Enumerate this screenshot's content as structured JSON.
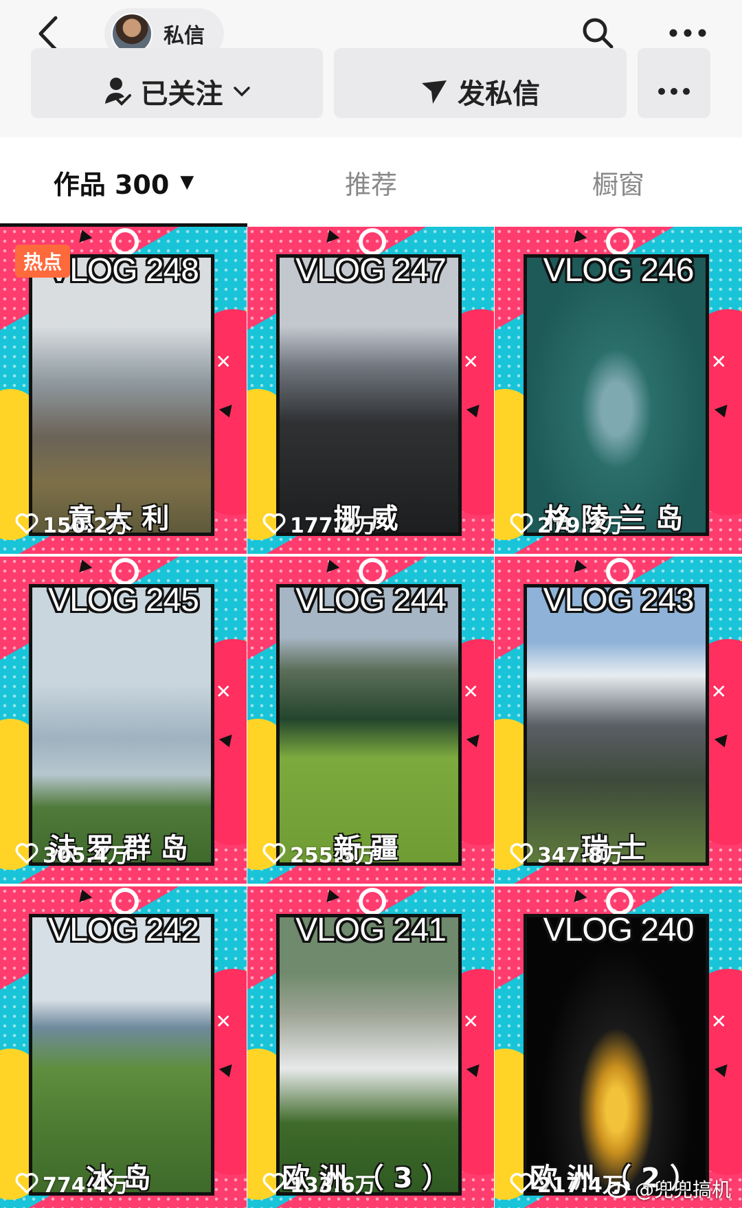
{
  "header": {
    "dm_label": "私信"
  },
  "actions": {
    "follow_label": "已关注",
    "message_label": "发私信"
  },
  "tabs": [
    {
      "label": "作品 300",
      "active": true
    },
    {
      "label": "推荐",
      "active": false
    },
    {
      "label": "橱窗",
      "active": false
    }
  ],
  "videos": [
    {
      "title": "VLOG 248",
      "place": "意大利",
      "likes": "150.2万",
      "badge": "热点"
    },
    {
      "title": "VLOG 247",
      "place": "挪威",
      "likes": "177.2万"
    },
    {
      "title": "VLOG 246",
      "place": "格陵兰岛",
      "likes": "279.2万"
    },
    {
      "title": "VLOG 245",
      "place": "法罗群岛",
      "likes": "305.4万"
    },
    {
      "title": "VLOG 244",
      "place": "新疆",
      "likes": "255.5万"
    },
    {
      "title": "VLOG 243",
      "place": "瑞士",
      "likes": "347.8万"
    },
    {
      "title": "VLOG 242",
      "place": "冰岛",
      "likes": "774.4万"
    },
    {
      "title": "VLOG 241",
      "place": "欧洲（3）",
      "likes": "133.6万"
    },
    {
      "title": "VLOG 240",
      "place": "欧洲（2）",
      "likes": "217.4万"
    }
  ],
  "watermark": "@兜兜搞机",
  "icons": {
    "back": "chevron-left-icon",
    "search": "search-icon",
    "more": "more-dots-icon",
    "follow": "user-check-icon",
    "message": "paper-plane-icon",
    "like": "heart-icon",
    "weibo": "weibo-logo-icon"
  },
  "colors": {
    "accent_pink": "#ff3c6e",
    "accent_cyan": "#19c4d8",
    "accent_yellow": "#ffd426",
    "hot_badge": "#ff6a3d"
  }
}
